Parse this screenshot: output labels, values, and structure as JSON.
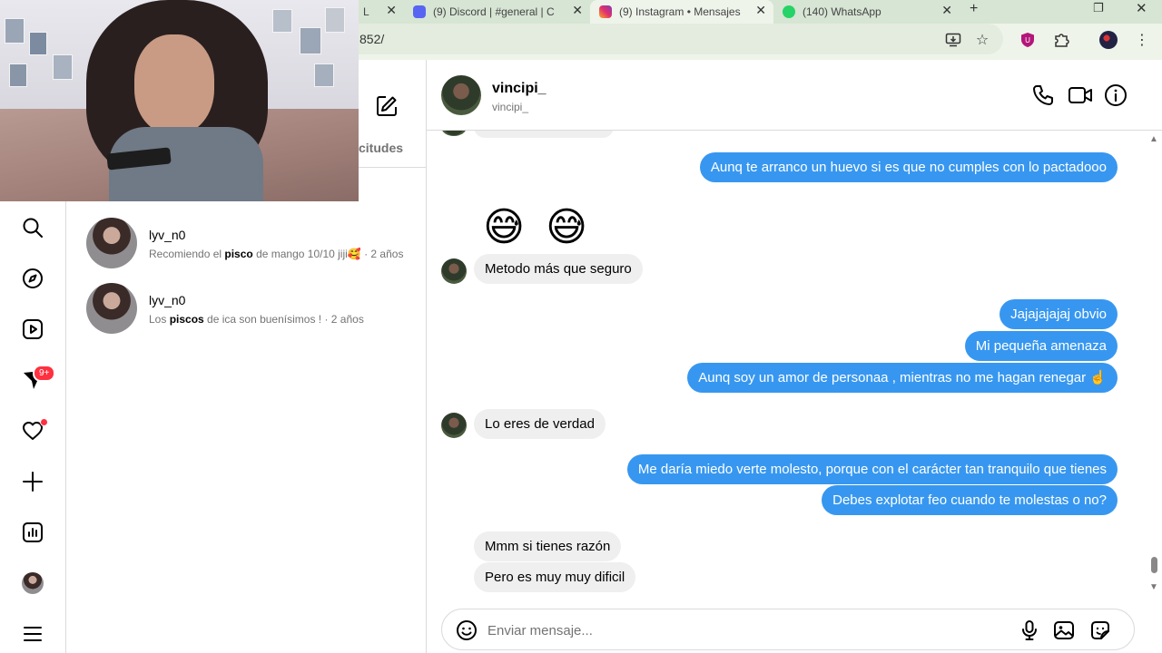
{
  "browser": {
    "tabs": [
      {
        "label": "L",
        "icon": "tab-icon",
        "color": "#c8d8c4"
      },
      {
        "label": "(9) Discord | #general | C",
        "icon": "discord-icon",
        "color": "#5865f2"
      },
      {
        "label": "(9) Instagram • Mensajes",
        "icon": "instagram-icon",
        "color": "#e1306c"
      },
      {
        "label": "(140) WhatsApp",
        "icon": "whatsapp-icon",
        "color": "#25d366"
      }
    ],
    "url": "852/"
  },
  "sidebar": {
    "badge": "9+",
    "items": [
      "search-icon",
      "explore-icon",
      "reels-icon",
      "messages-icon",
      "notifications-icon",
      "create-icon",
      "dashboard-icon",
      "profile-avatar",
      "menu-icon"
    ]
  },
  "conversations_panel": {
    "requests_label": "citudes",
    "items": [
      {
        "name": "lyv_n0",
        "pre": "Recomiendo el ",
        "bold": "pisco",
        "post": " de mango 10/10 jiji🥰",
        "time": " · 2 años"
      },
      {
        "name": "lyv_n0",
        "pre": "Los ",
        "bold": "piscos",
        "post": " de ica son buenísimos ! ",
        "time": "· 2 años"
      }
    ]
  },
  "chat": {
    "name": "vincipi_",
    "username": "vincipi_",
    "messages": {
      "m1": "Aunq te arranco un huevo si es que no cumples con lo pactadooo",
      "emoji1": "😅",
      "emoji2": "😅",
      "m2": "Metodo más que seguro",
      "m3": "Jajajajajaj obvio",
      "m4": "Mi pequeña amenaza",
      "m5": "Aunq soy un amor de personaa , mientras no me hagan renegar ☝️",
      "m6": "Lo eres de verdad",
      "m7": "Me daría miedo verte molesto, porque con el carácter tan tranquilo que tienes",
      "m8": "Debes explotar feo cuando te molestas o no?",
      "m9": "Mmm si tienes razón",
      "m10": "Pero es muy muy dificil"
    },
    "input_placeholder": "Enviar mensaje..."
  },
  "colors": {
    "outgoing_bubble": "#3797f0",
    "incoming_bubble": "#efefef",
    "notification": "#ff3040"
  }
}
